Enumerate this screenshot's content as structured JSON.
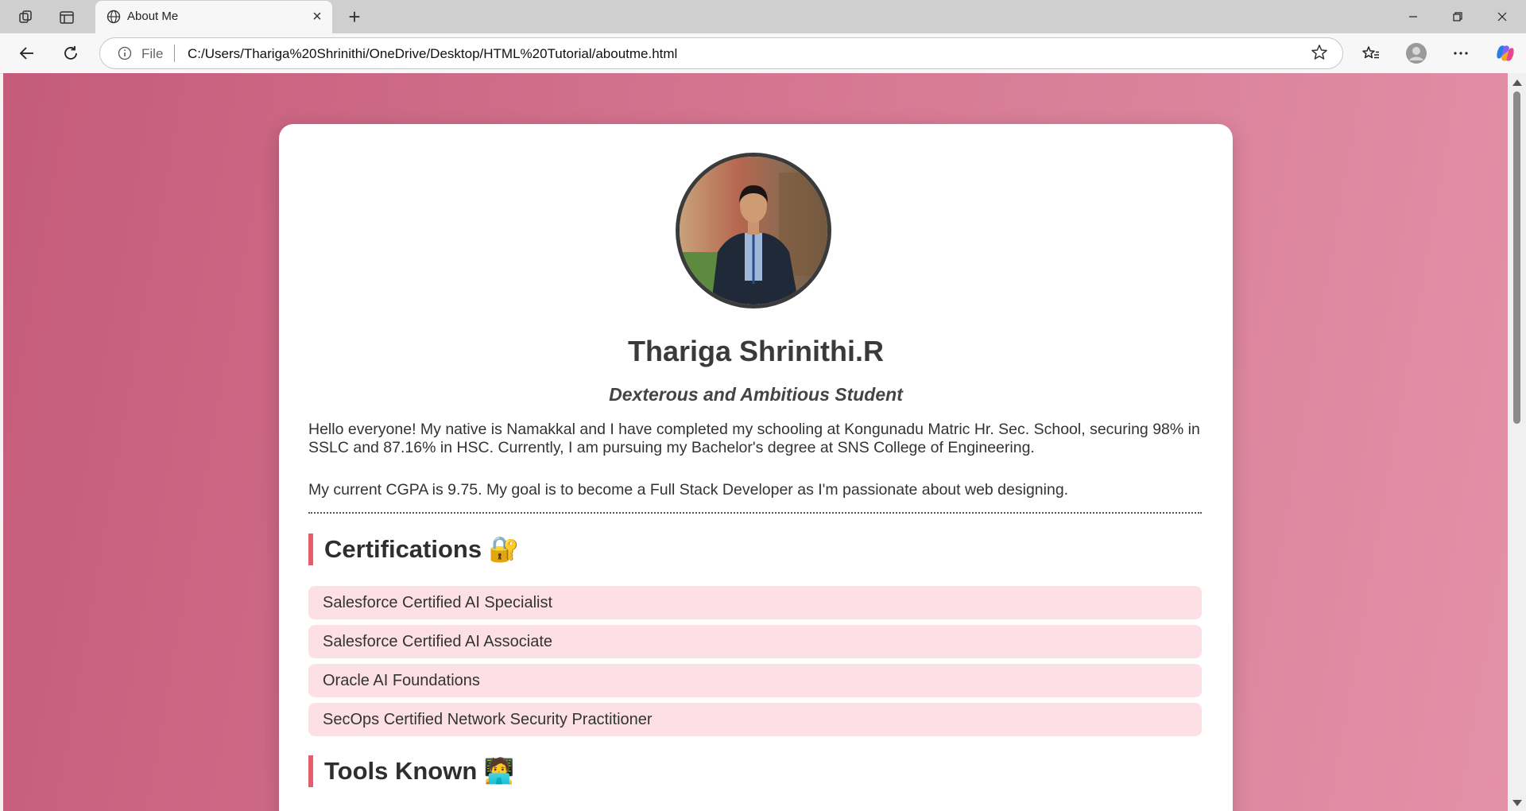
{
  "browser": {
    "tab_title": "About Me",
    "address_scheme_label": "File",
    "address_url": "C:/Users/Thariga%20Shrinithi/OneDrive/Desktop/HTML%20Tutorial/aboutme.html"
  },
  "profile": {
    "name": "Thariga Shrinithi.R",
    "tagline": "Dexterous and Ambitious Student",
    "bio_paragraph_1": "Hello everyone! My native is Namakkal and I have completed my schooling at Kongunadu Matric Hr. Sec. School, securing 98% in SSLC and 87.16% in HSC. Currently, I am pursuing my Bachelor's degree at SNS College of Engineering.",
    "bio_paragraph_2": "My current CGPA is 9.75. My goal is to become a Full Stack Developer as I'm passionate about web designing."
  },
  "certifications": {
    "title": "Certifications 🔐",
    "items": [
      "Salesforce Certified AI Specialist",
      "Salesforce Certified AI Associate",
      "Oracle AI Foundations",
      "SecOps Certified Network Security Practitioner"
    ]
  },
  "tools": {
    "title": "Tools Known 🧑‍💻"
  },
  "colors": {
    "gradient_start": "#c45b7a",
    "gradient_end": "#e391a8",
    "accent_bar": "#e35d6a",
    "cert_item_bg": "#fde0e6"
  }
}
